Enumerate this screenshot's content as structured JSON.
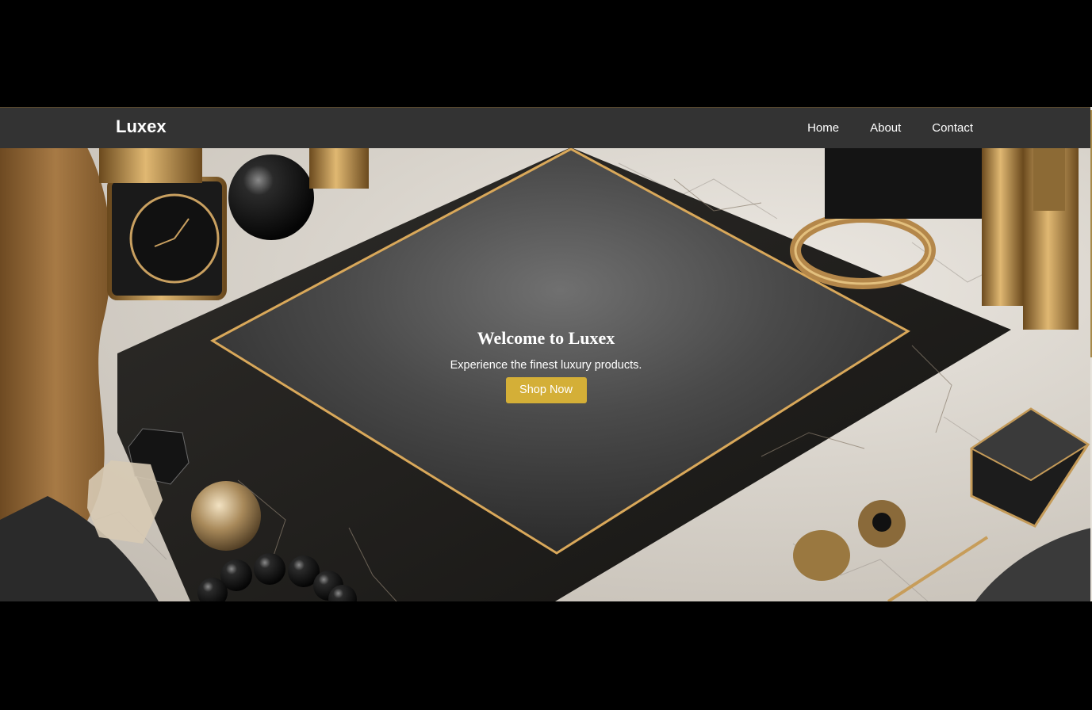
{
  "site": {
    "brand": "Luxex"
  },
  "nav": {
    "items": [
      {
        "label": "Home"
      },
      {
        "label": "About"
      },
      {
        "label": "Contact"
      }
    ]
  },
  "hero": {
    "title": "Welcome to Luxex",
    "subtitle": "Experience the finest luxury products.",
    "cta_label": "Shop Now"
  },
  "colors": {
    "navbar_bg": "#333333",
    "accent_gold": "#d4af37",
    "page_bg": "#000000",
    "text_light": "#ffffff"
  }
}
